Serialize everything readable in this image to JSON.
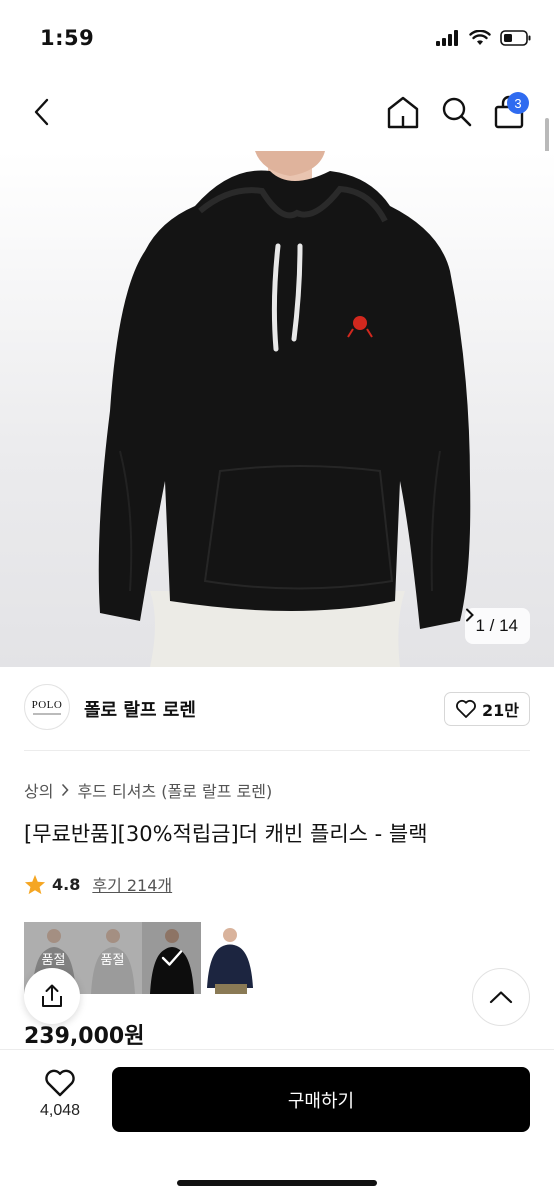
{
  "status_bar": {
    "time": "1:59"
  },
  "nav": {
    "cart_count": "3"
  },
  "gallery": {
    "pager": "1 / 14"
  },
  "brand": {
    "logo_text": "POLO",
    "name": "폴로 랄프 로렌",
    "likes": "21만"
  },
  "breadcrumb": {
    "category": "상의",
    "subcategory": "후드 티셔츠 (폴로 랄프 로렌)"
  },
  "product": {
    "title": "[무료반품][30%적립금]더 캐빈 플리스 - 블랙",
    "rating": "4.8",
    "reviews": "후기 214개",
    "price": "239,000원"
  },
  "swatches": [
    {
      "label": "품절",
      "color": "grey",
      "state": "sold-out"
    },
    {
      "label": "품절",
      "color": "light-grey",
      "state": "sold-out"
    },
    {
      "label": "",
      "color": "black",
      "state": "selected"
    },
    {
      "label": "",
      "color": "navy",
      "state": "available"
    }
  ],
  "bottom": {
    "wish_count": "4,048",
    "buy_label": "구매하기"
  },
  "colors": {
    "accent_badge": "#2f6bf0",
    "buy_button": "#000000",
    "star": "#f5a623",
    "logo_red": "#d2281e"
  },
  "icons": [
    "back-icon",
    "home-icon",
    "search-icon",
    "shopping-bag-icon",
    "heart-icon",
    "star-icon",
    "share-icon",
    "chevron-up-icon",
    "chevron-right-icon",
    "checkmark-icon"
  ]
}
